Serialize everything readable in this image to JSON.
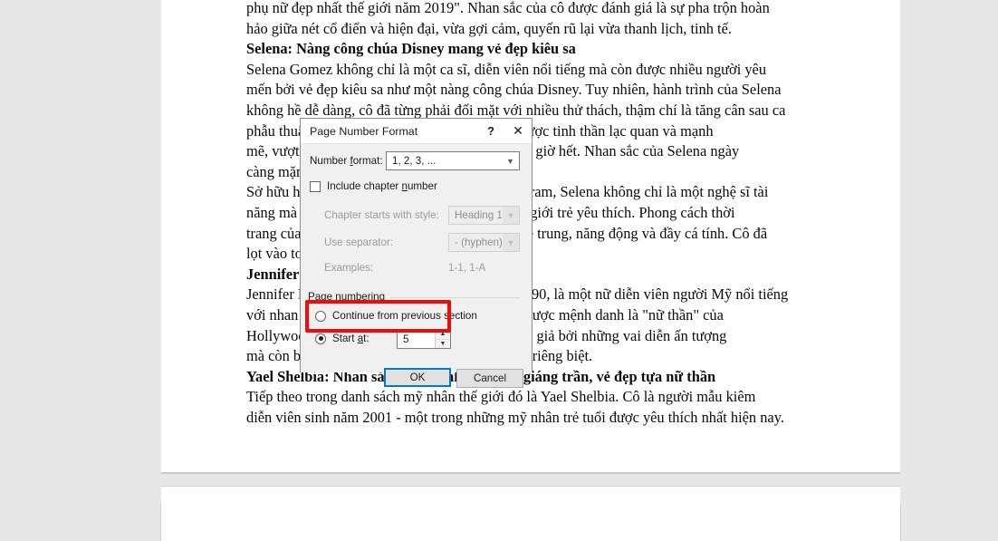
{
  "app": {
    "canvas_background": "#e7e7e7",
    "page_background": "#ffffff"
  },
  "document": {
    "lines": [
      {
        "text": "phụ nữ đẹp nhất thế giới năm 2019\". Nhan sắc của cô được đánh giá là sự pha trộn hoàn",
        "bold": false
      },
      {
        "text": "hảo giữa nét cổ điển và hiện đại, vừa gợi cảm, quyến rũ lại vừa thanh lịch, tinh tế.",
        "bold": false
      },
      {
        "text": "Selena: Nàng công chúa Disney mang vẻ đẹp kiêu sa",
        "bold": true
      },
      {
        "text": "Selena Gomez không chỉ là một ca sĩ, diễn viên nổi tiếng mà còn được nhiều người yêu",
        "bold": false
      },
      {
        "text": "mến bởi vẻ đẹp kiêu sa như một nàng công chúa Disney. Tuy nhiên, hành trình của Selena",
        "bold": false
      },
      {
        "text": "không hề dễ dàng, cô đã từng phải đối mặt với nhiều thử thách, thậm chí là tăng cân sau ca",
        "bold": false
      },
      {
        "text": "phẫu thuật ghép thận. Nhưng Selena luôn giữ được tinh thần lạc quan và mạnh",
        "bold": false
      },
      {
        "text": "mẽ, vượt qua mọi khó khăn và toả sáng hơn bao giờ hết. Nhan sắc của Selena ngày",
        "bold": false
      },
      {
        "text": "càng mặn mà, cuốn hút hơn bao giờ hết.",
        "bold": false
      },
      {
        "text": "Sở hữu hơn 400 triệu người theo dõi trên Instagram, Selena không chỉ là một nghệ sĩ tài",
        "bold": false
      },
      {
        "text": "năng mà còn là một biểu tượng thời trang được giới trẻ yêu thích. Phong cách thời",
        "bold": false
      },
      {
        "text": "trang của cô nàng luôn toát lên vẻ đẹp của sự trẻ trung, năng động và đầy cá tính. Cô đã",
        "bold": false
      },
      {
        "text": "lọt vào top những mỹ nhân đẹp nhất hành tinh.",
        "bold": false
      },
      {
        "text": "Jennifer Lawrence: Nữ thần của Hollywood",
        "bold": true
      },
      {
        "text": "Jennifer Lawrence sinh ngày 15 tháng 8 năm 1990, là một nữ diễn viên người Mỹ nổi tiếng",
        "bold": false
      },
      {
        "text": "với nhan sắc xinh đẹp và tài năng xuất chúng. Được mệnh danh là \"nữ thần\" của",
        "bold": false
      },
      {
        "text": "Hollywood, Jennifer không chỉ chinh phục khán giả bởi những vai diễn ấn tượng",
        "bold": false
      },
      {
        "text": "mà còn bởi vẻ đẹp tự nhiên, cuốn hút và cá tính riêng biệt.",
        "bold": false
      },
      {
        "text": "Yael Shelbia: Nhan sắc được ví như tiên nữ giáng trần, vẻ đẹp tựa nữ thần",
        "bold": true
      },
      {
        "text": "Tiếp theo trong danh sách mỹ nhân thế giới đó là Yael Shelbia. Cô là người mẫu kiêm",
        "bold": false
      },
      {
        "text": "diễn viên sinh năm 2001 - một trong những mỹ nhân trẻ tuổi được yêu thích nhất hiện nay.",
        "bold": false
      }
    ]
  },
  "dialog": {
    "title": "Page Number Format",
    "help_icon": "?",
    "close_icon": "✕",
    "number_format": {
      "label_pre": "Number ",
      "label_underlined": "f",
      "label_post": "ormat:",
      "label_full": "Number format:",
      "value": "1, 2, 3, ...",
      "arrow_icon": "chevron-down-icon"
    },
    "include_chapter": {
      "label_full": "Include chapter number",
      "checked": false
    },
    "chapter_style": {
      "label_full": "Chapter starts with style:",
      "value": "Heading 1",
      "disabled": true
    },
    "separator": {
      "label_full": "Use separator:",
      "value": "-     (hyphen)",
      "disabled": true
    },
    "examples": {
      "label_full": "Examples:",
      "value": "1-1, 1-A"
    },
    "page_numbering": {
      "group_label": "Page numbering",
      "continue_label": "Continue from previous section",
      "continue_selected": false,
      "start_at_label": "Start at:",
      "start_at_selected": true,
      "start_at_value": "5",
      "spinner_up": "▲",
      "spinner_down": "▼"
    },
    "buttons": {
      "ok": "OK",
      "cancel": "Cancel"
    }
  },
  "annotation": {
    "highlight_color": "#f00b0b",
    "target": "start-at-row"
  }
}
